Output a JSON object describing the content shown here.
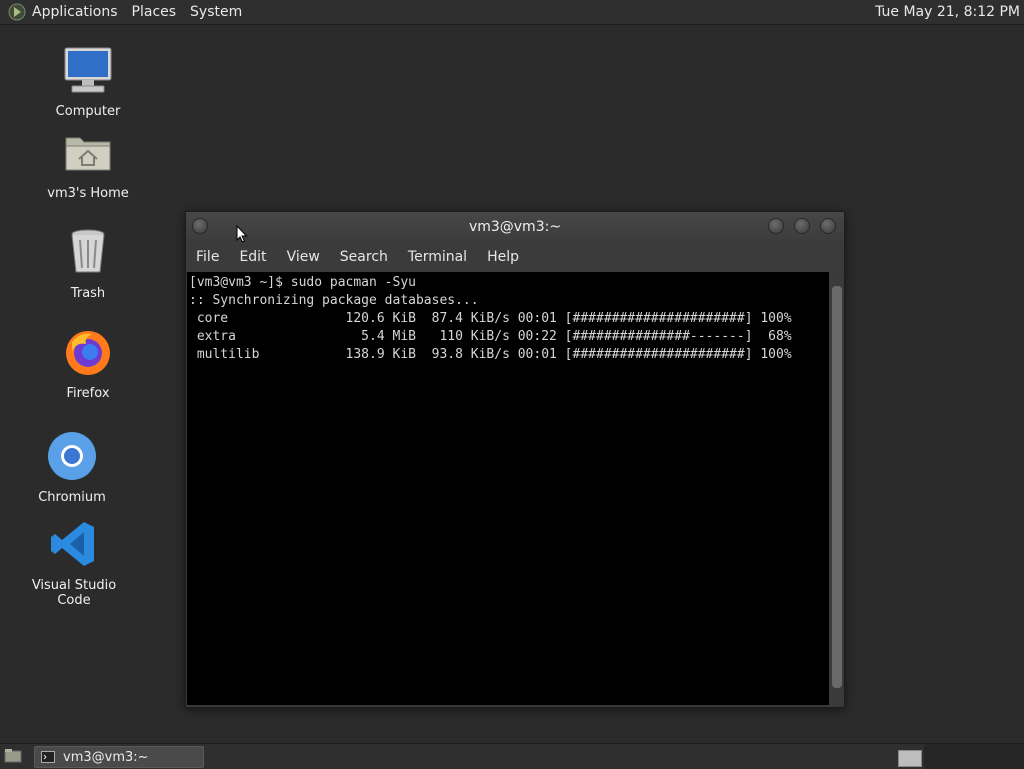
{
  "top_panel": {
    "menus": [
      "Applications",
      "Places",
      "System"
    ],
    "clock": "Tue May 21,  8:12 PM"
  },
  "desktop": {
    "icons": [
      {
        "label": "Computer",
        "icon": "computer-icon"
      },
      {
        "label": "vm3's Home",
        "icon": "home-folder-icon"
      },
      {
        "label": "Trash",
        "icon": "trash-icon"
      },
      {
        "label": "Firefox",
        "icon": "firefox-icon"
      },
      {
        "label": "Chromium",
        "icon": "chromium-icon"
      },
      {
        "label": "Visual Studio Code",
        "icon": "vscode-icon"
      }
    ]
  },
  "terminal": {
    "title": "vm3@vm3:~",
    "menu": [
      "File",
      "Edit",
      "View",
      "Search",
      "Terminal",
      "Help"
    ],
    "lines": [
      "[vm3@vm3 ~]$ sudo pacman -Syu",
      ":: Synchronizing package databases...",
      " core               120.6 KiB  87.4 KiB/s 00:01 [######################] 100%",
      " extra                5.4 MiB   110 KiB/s 00:22 [###############-------]  68%",
      " multilib           138.9 KiB  93.8 KiB/s 00:01 [######################] 100%"
    ]
  },
  "taskbar": {
    "task_label": "vm3@vm3:~"
  },
  "colors": {
    "desktop_bg": "#2b2b2b",
    "panel_bg": "#2f2f2f",
    "terminal_bg": "#000000",
    "terminal_fg": "#d6d6d6"
  }
}
